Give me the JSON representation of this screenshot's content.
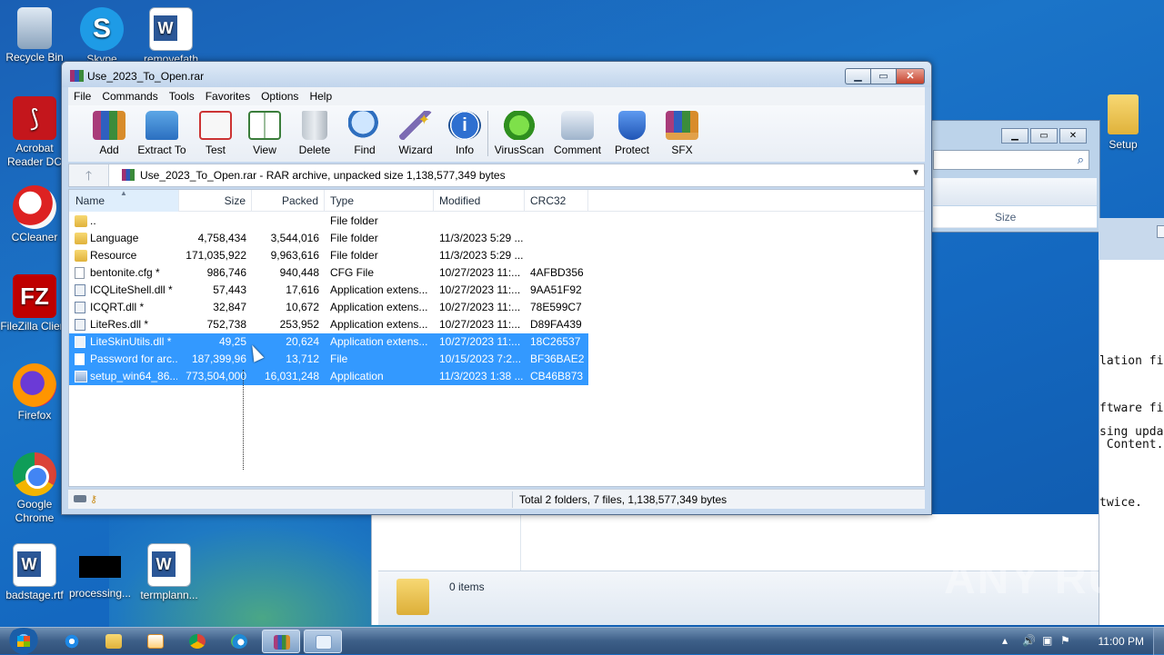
{
  "desktop": {
    "icons": [
      {
        "label": "Recycle Bin"
      },
      {
        "label": "Skype"
      },
      {
        "label": "removefath"
      },
      {
        "label": "Acrobat Reader DC"
      },
      {
        "label": "CCleaner"
      },
      {
        "label": "FileZilla Client"
      },
      {
        "label": "Firefox"
      },
      {
        "label": "Google Chrome"
      },
      {
        "label": "badstage.rtf"
      },
      {
        "label": "processing..."
      },
      {
        "label": "termplann..."
      },
      {
        "label": "Setup"
      }
    ],
    "watermark": "ANY RUN"
  },
  "winrar": {
    "title": "Use_2023_To_Open.rar",
    "menu": [
      "File",
      "Commands",
      "Tools",
      "Favorites",
      "Options",
      "Help"
    ],
    "toolbar": [
      "Add",
      "Extract To",
      "Test",
      "View",
      "Delete",
      "Find",
      "Wizard",
      "Info",
      "VirusScan",
      "Comment",
      "Protect",
      "SFX"
    ],
    "address": "Use_2023_To_Open.rar - RAR archive, unpacked size 1,138,577,349 bytes",
    "columns": {
      "name": "Name",
      "size": "Size",
      "packed": "Packed",
      "type": "Type",
      "modified": "Modified",
      "crc": "CRC32"
    },
    "rows": [
      {
        "name": "..",
        "size": "",
        "packed": "",
        "type": "File folder",
        "modified": "",
        "crc": "",
        "icon": "folder",
        "selected": false
      },
      {
        "name": "Language",
        "size": "4,758,434",
        "packed": "3,544,016",
        "type": "File folder",
        "modified": "11/3/2023 5:29 ...",
        "crc": "",
        "icon": "folder",
        "selected": false
      },
      {
        "name": "Resource",
        "size": "171,035,922",
        "packed": "9,963,616",
        "type": "File folder",
        "modified": "11/3/2023 5:29 ...",
        "crc": "",
        "icon": "folder",
        "selected": false
      },
      {
        "name": "bentonite.cfg *",
        "size": "986,746",
        "packed": "940,448",
        "type": "CFG File",
        "modified": "10/27/2023 11:...",
        "crc": "4AFBD356",
        "icon": "file",
        "selected": false
      },
      {
        "name": "ICQLiteShell.dll *",
        "size": "57,443",
        "packed": "17,616",
        "type": "Application extens...",
        "modified": "10/27/2023 11:...",
        "crc": "9AA51F92",
        "icon": "dll",
        "selected": false
      },
      {
        "name": "ICQRT.dll *",
        "size": "32,847",
        "packed": "10,672",
        "type": "Application extens...",
        "modified": "10/27/2023 11:...",
        "crc": "78E599C7",
        "icon": "dll",
        "selected": false
      },
      {
        "name": "LiteRes.dll *",
        "size": "752,738",
        "packed": "253,952",
        "type": "Application extens...",
        "modified": "10/27/2023 11:...",
        "crc": "D89FA439",
        "icon": "dll",
        "selected": false
      },
      {
        "name": "LiteSkinUtils.dll *",
        "size": "49,25",
        "packed": "20,624",
        "type": "Application extens...",
        "modified": "10/27/2023 11:...",
        "crc": "18C26537",
        "icon": "dll",
        "selected": true
      },
      {
        "name": "Password for arc...",
        "size": "187,399,96",
        "packed": "13,712",
        "type": "File",
        "modified": "10/15/2023 7:2...",
        "crc": "BF36BAE2",
        "icon": "file",
        "selected": true
      },
      {
        "name": "setup_win64_86....",
        "size": "773,504,000",
        "packed": "16,031,248",
        "type": "Application",
        "modified": "11/3/2023 1:38 ...",
        "crc": "CB46B873",
        "icon": "app",
        "selected": true
      }
    ],
    "status": "Total 2 folders, 7 files, 1,138,577,349 bytes"
  },
  "explorer": {
    "column_size": "Size",
    "items_count": "0 items"
  },
  "console": {
    "lines": [
      "lation fil",
      "ftware fin",
      "sing updat",
      " Content.",
      "twice."
    ]
  },
  "taskbar": {
    "clock": "11:00 PM"
  },
  "colors": {
    "selection": "#3399ff",
    "desktop": "#1b74c8"
  }
}
